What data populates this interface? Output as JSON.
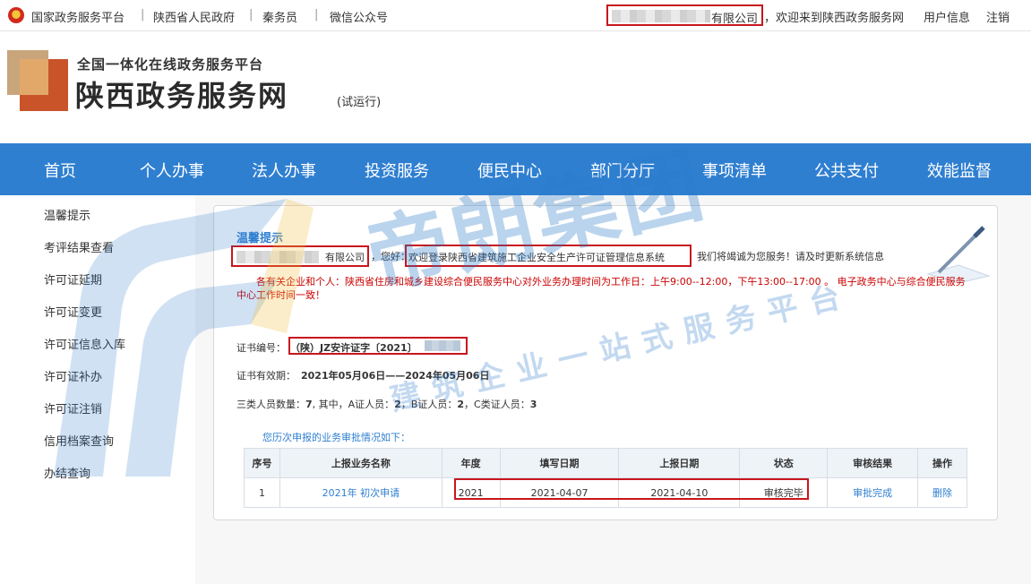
{
  "topbar": {
    "links": [
      "国家政务服务平台",
      "陕西省人民政府",
      "秦务员",
      "微信公众号"
    ],
    "company_suffix": "有限公司",
    "welcome": "，欢迎来到陕西政务服务网",
    "user_info": "用户信息",
    "logout": "注销"
  },
  "header": {
    "platform": "全国一体化在线政务服务平台",
    "site_name": "陕西政务服务网",
    "trial": "(试运行)"
  },
  "nav": [
    "首页",
    "个人办事",
    "法人办事",
    "投资服务",
    "便民中心",
    "部门分厅",
    "事项清单",
    "公共支付",
    "效能监督"
  ],
  "sidebar": [
    "温馨提示",
    "考评结果查看",
    "许可证延期",
    "许可证变更",
    "许可证信息入库",
    "许可证补办",
    "许可证注销",
    "信用档案查询",
    "办结查询"
  ],
  "watermark": {
    "big": "帝朗集团",
    "small": "建筑企业一站式服务平台"
  },
  "main": {
    "tip_title": "温馨提示",
    "company_suffix": "有限公司",
    "hello": "，您好：",
    "system_welcome": "欢迎登录陕西省建筑施工企业安全生产许可证管理信息系统",
    "service_msg": "我们将竭诚为您服务！请及时更新系统信息",
    "notice": "各有关企业和个人：陕西省住房和城乡建设综合便民服务中心对外业务办理时间为工作日：上午9:00--12:00，下午13:00--17:00 。 电子政务中心与综合便民服务中心工作时间一致！",
    "cert_label": "证书编号：",
    "cert_value": "（陕）JZ安许证字〔2021〕",
    "validity_label": "证书有效期：",
    "validity_value": "2021年05月06日——2024年05月06日",
    "staff_label": "三类人员数量：",
    "staff_total": "7",
    "staff_mid": ", 其中，A证人员：",
    "staff_a": "2",
    "staff_b_label": "，B证人员：",
    "staff_b": "2",
    "staff_c_label": "，C类证人员：",
    "staff_c": "3",
    "history_title": "您历次申报的业务审批情况如下：",
    "table": {
      "headers": [
        "序号",
        "上报业务名称",
        "年度",
        "填写日期",
        "上报日期",
        "状态",
        "审核结果",
        "操作"
      ],
      "rows": [
        [
          "1",
          "2021年 初次申请",
          "2021",
          "2021-04-07",
          "2021-04-10",
          "审核完毕",
          "审批完成",
          "删除"
        ]
      ]
    }
  }
}
